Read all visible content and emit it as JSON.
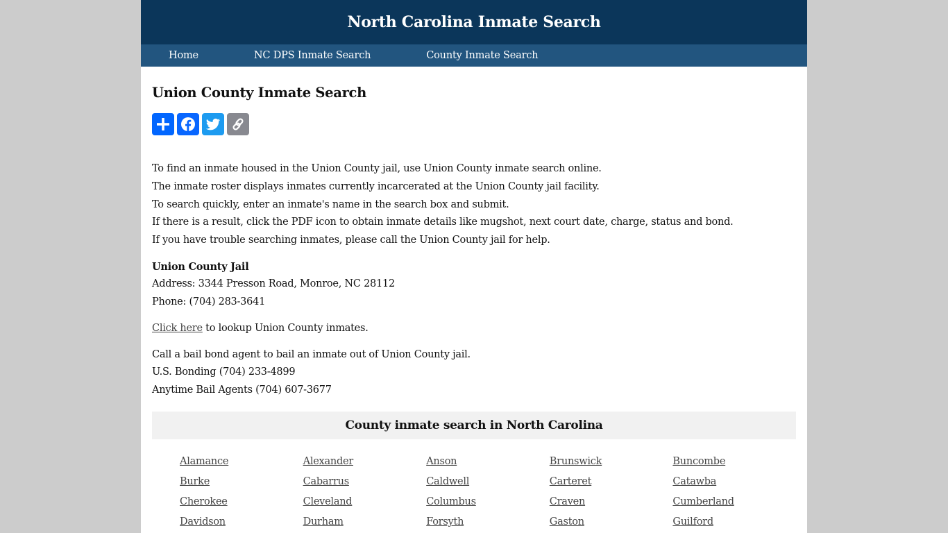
{
  "header": {
    "site_title": "North Carolina Inmate Search"
  },
  "nav": {
    "items": [
      {
        "label": "Home"
      },
      {
        "label": "NC DPS Inmate Search"
      },
      {
        "label": "County Inmate Search"
      }
    ]
  },
  "main": {
    "title": "Union County Inmate Search",
    "share_buttons": [
      {
        "name": "share-add",
        "icon": "plus-icon",
        "color": "#0166ff"
      },
      {
        "name": "share-facebook",
        "icon": "facebook-icon",
        "color": "#0866ff"
      },
      {
        "name": "share-twitter",
        "icon": "twitter-icon",
        "color": "#1d9bf0"
      },
      {
        "name": "share-copy-link",
        "icon": "link-icon",
        "color": "#888990"
      }
    ],
    "intro_lines": [
      "To find an inmate housed in the Union County jail, use Union County inmate search online.",
      "The inmate roster displays inmates currently incarcerated at the Union County jail facility.",
      "To search quickly, enter an inmate's name in the search box and submit.",
      "If there is a result, click the PDF icon to obtain inmate details like mugshot, next court date, charge, status and bond.",
      "If you have trouble searching inmates, please call the Union County jail for help."
    ],
    "jail": {
      "name": "Union County Jail",
      "address": "Address: 3344 Presson Road, Monroe, NC 28112",
      "phone": "Phone: (704) 283-3641"
    },
    "lookup": {
      "link_label": "Click here",
      "suffix": " to lookup Union County inmates."
    },
    "bail": {
      "intro": "Call a bail bond agent to bail an inmate out of Union County jail.",
      "agents": [
        "U.S. Bonding (704) 233-4899",
        "Anytime Bail Agents (704) 607-3677"
      ]
    },
    "county_section": {
      "title": "County inmate search in North Carolina",
      "counties": [
        "Alamance",
        "Alexander",
        "Anson",
        "Brunswick",
        "Buncombe",
        "Burke",
        "Cabarrus",
        "Caldwell",
        "Carteret",
        "Catawba",
        "Cherokee",
        "Cleveland",
        "Columbus",
        "Craven",
        "Cumberland",
        "Davidson",
        "Durham",
        "Forsyth",
        "Gaston",
        "Guilford"
      ]
    }
  },
  "colors": {
    "header_bg": "#0b365a",
    "nav_bg": "#22557f",
    "page_bg": "#cccccc",
    "section_bg": "#f1f1f1",
    "link": "#444444"
  }
}
